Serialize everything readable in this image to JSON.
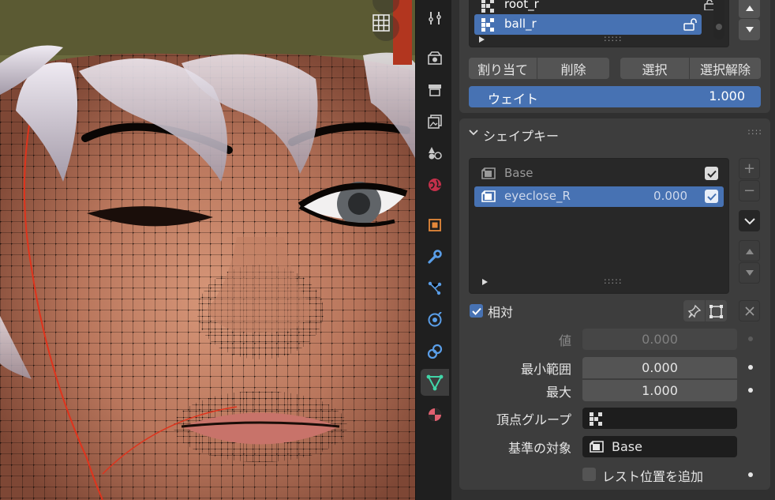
{
  "vertex_groups": {
    "rows": [
      {
        "name": "root_r",
        "selected": false
      },
      {
        "name": "ball_r",
        "selected": true
      }
    ],
    "buttons": {
      "assign": "割り当て",
      "remove": "削除",
      "select": "選択",
      "deselect": "選択解除"
    },
    "weight": {
      "label": "ウェイト",
      "value": "1.000"
    }
  },
  "shape_keys": {
    "title": "シェイプキー",
    "rows": [
      {
        "name": "Base",
        "value": "",
        "checked": true,
        "selected": false
      },
      {
        "name": "eyeclose_R",
        "value": "0.000",
        "checked": true,
        "selected": true
      }
    ],
    "relative": {
      "label": "相対",
      "checked": true
    },
    "value": {
      "label": "値",
      "value": "0.000"
    },
    "range_min": {
      "label": "最小範囲",
      "value": "0.000"
    },
    "range_max": {
      "label": "最大",
      "value": "1.000"
    },
    "vertex_group": {
      "label": "頂点グループ",
      "value": ""
    },
    "relative_to": {
      "label": "基準の対象",
      "value": "Base"
    },
    "add_rest_position": {
      "label": "レスト位置を追加",
      "checked": false
    }
  },
  "colors": {
    "accent": "#4772b3",
    "panel": "#3d3d3d",
    "editor": "#303030",
    "mesh_active_tab": "#41d6a8"
  },
  "tab_icons": [
    "tool-icon",
    "render-icon",
    "output-icon",
    "view-layer-icon",
    "scene-icon",
    "world-icon",
    "object-icon",
    "modifier-icon",
    "particles-icon",
    "physics-icon",
    "constraints-icon",
    "data-icon",
    "material-icon"
  ]
}
